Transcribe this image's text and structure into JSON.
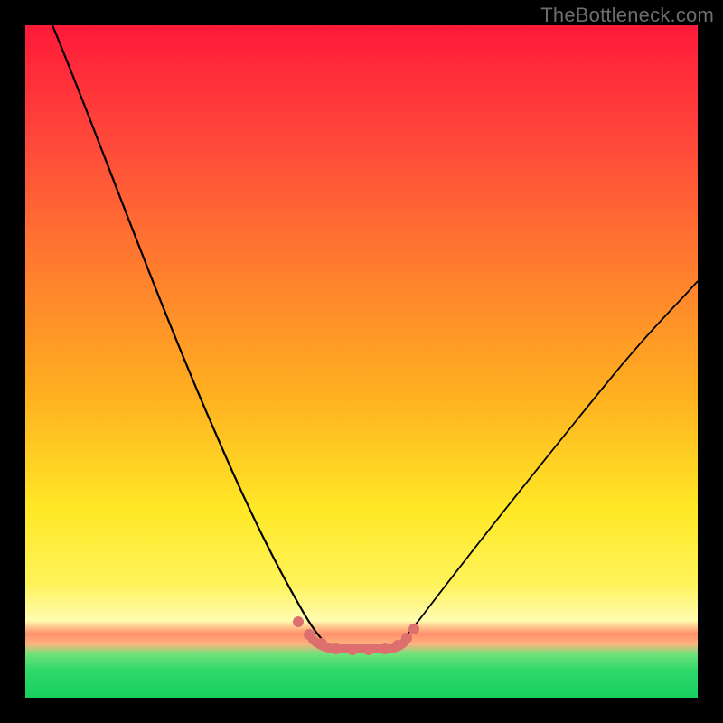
{
  "watermark": "TheBottleneck.com",
  "chart_data": {
    "type": "line",
    "title": "",
    "xlabel": "",
    "ylabel": "",
    "xlim": [
      0,
      100
    ],
    "ylim": [
      0,
      100
    ],
    "grid": false,
    "legend": false,
    "series": [
      {
        "name": "left-branch",
        "color": "#000000",
        "x": [
          4,
          8,
          12,
          16,
          20,
          24,
          28,
          32,
          35,
          37,
          39,
          40.5,
          42,
          43,
          44,
          45
        ],
        "values": [
          100,
          90,
          80,
          70,
          60,
          50,
          41,
          32,
          24,
          18,
          13,
          10,
          8.5,
          8.2,
          8,
          8
        ]
      },
      {
        "name": "right-branch",
        "color": "#000000",
        "x": [
          52,
          53,
          54,
          55,
          57,
          60,
          64,
          70,
          78,
          86,
          93,
          100
        ],
        "values": [
          8,
          8.2,
          8.5,
          9,
          11,
          15,
          21,
          30,
          40,
          49,
          56,
          62
        ]
      },
      {
        "name": "bottom-markers",
        "color": "#e07070",
        "x": [
          40,
          42,
          44,
          46,
          48,
          50,
          52,
          54,
          55,
          56
        ],
        "values": [
          10,
          9,
          8.2,
          8,
          8,
          8,
          8,
          8.5,
          9,
          10
        ]
      }
    ],
    "background_gradient_stops": [
      {
        "pos": 0.0,
        "color": "#ff1a3a"
      },
      {
        "pos": 0.35,
        "color": "#ff7a2f"
      },
      {
        "pos": 0.72,
        "color": "#ffe826"
      },
      {
        "pos": 0.885,
        "color": "#fffcb0"
      },
      {
        "pos": 0.905,
        "color": "#ff8f6a"
      },
      {
        "pos": 0.935,
        "color": "#6fe27a"
      },
      {
        "pos": 1.0,
        "color": "#17d05e"
      }
    ]
  }
}
